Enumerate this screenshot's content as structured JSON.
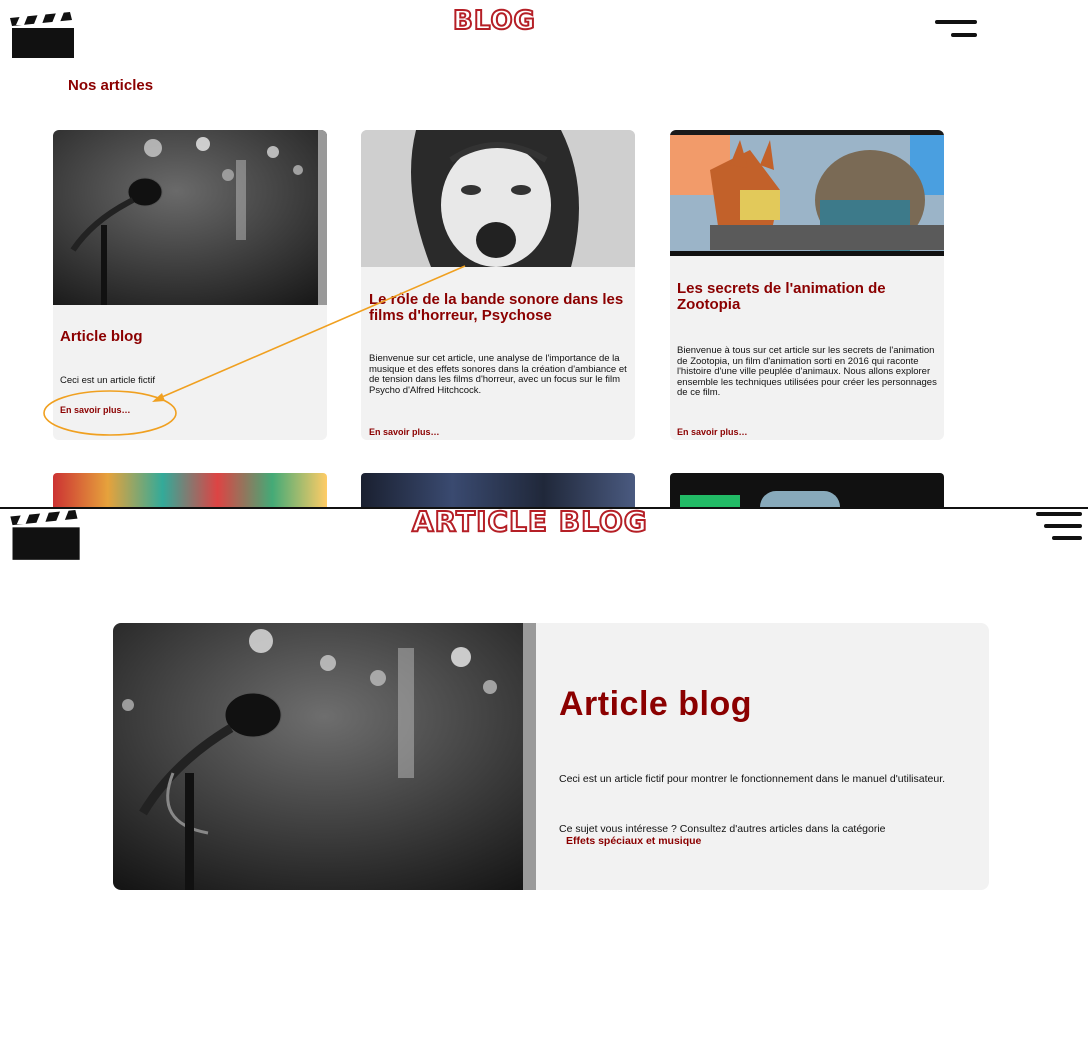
{
  "blog_page": {
    "title": "BLOG",
    "section_title": "Nos articles",
    "logo_icon": "clapperboard-icon",
    "menu_icon": "hamburger-menu-icon",
    "cards": [
      {
        "title": "Article blog",
        "excerpt": "Ceci est un article fictif",
        "link": "En savoir plus…",
        "image": "microphone-photo"
      },
      {
        "title": "Le rôle de la bande sonore dans les films d'horreur, Psychose",
        "excerpt": "Bienvenue sur cet article, une analyse de l'importance de la musique et des effets sonores dans la création d'ambiance et de tension dans les films d'horreur, avec un focus sur le film Psycho d'Alfred Hitchcock.",
        "link": "En savoir plus…",
        "image": "psycho-scream-photo"
      },
      {
        "title": "Les secrets de l'animation de Zootopia",
        "excerpt": "Bienvenue à tous sur cet article sur les secrets de l'animation de Zootopia, un film d'animation sorti en 2016 qui raconte l'histoire d'une ville peuplée d'animaux. Nous allons explorer ensemble les techniques utilisées pour créer les personnages de ce film.",
        "link": "En savoir plus…",
        "image": "zootopia-still"
      }
    ],
    "annotation_color": "#f0a020"
  },
  "article_page": {
    "title": "ARTICLE BLOG",
    "logo_icon": "clapperboard-icon",
    "menu_icon": "hamburger-menu-icon",
    "heading": "Article blog",
    "paragraph1": "Ceci est un article fictif pour montrer le fonctionnement dans le manuel d'utilisateur.",
    "paragraph2": "Ce sujet vous intéresse ? Consultez d'autres articles dans la catégorie",
    "category_link": "Effets spéciaux et musique",
    "image": "microphone-photo"
  },
  "colors": {
    "accent": "#8b0000",
    "title_outline": "#b51f26",
    "card_bg": "#f2f2f2"
  }
}
